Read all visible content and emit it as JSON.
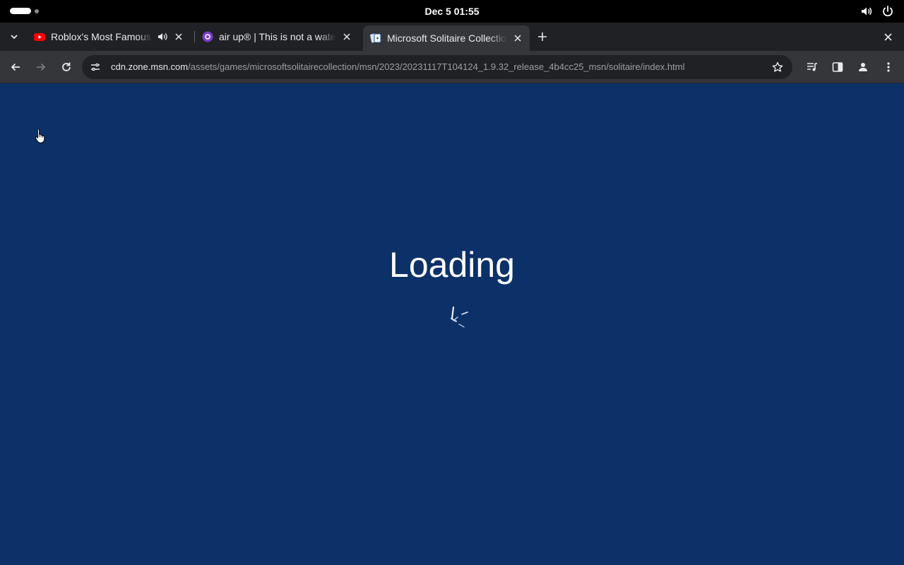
{
  "system_bar": {
    "clock": "Dec 5  01:55",
    "icons": [
      "volume-icon",
      "power-icon"
    ]
  },
  "tabs": [
    {
      "title": "Roblox's Most Famous",
      "favicon": "youtube-icon",
      "audio": true,
      "active": false
    },
    {
      "title": "air up® | This is not a water",
      "favicon": "airup-icon",
      "audio": false,
      "active": false
    },
    {
      "title": "Microsoft Solitaire Collection",
      "favicon": "solitaire-icon",
      "audio": false,
      "active": true
    }
  ],
  "address_bar": {
    "host": "cdn.zone.msn.com",
    "path": "/assets/games/microsoftsolitairecollection/msn/2023/20231117T104124_1.9.32_release_4b4cc25_msn/solitaire/index.html"
  },
  "page": {
    "loading_text": "Loading",
    "background_color": "#0c3169"
  },
  "colors": {
    "accent": "#0c3169",
    "tab_active": "#35363a",
    "tab_strip": "#202124"
  }
}
